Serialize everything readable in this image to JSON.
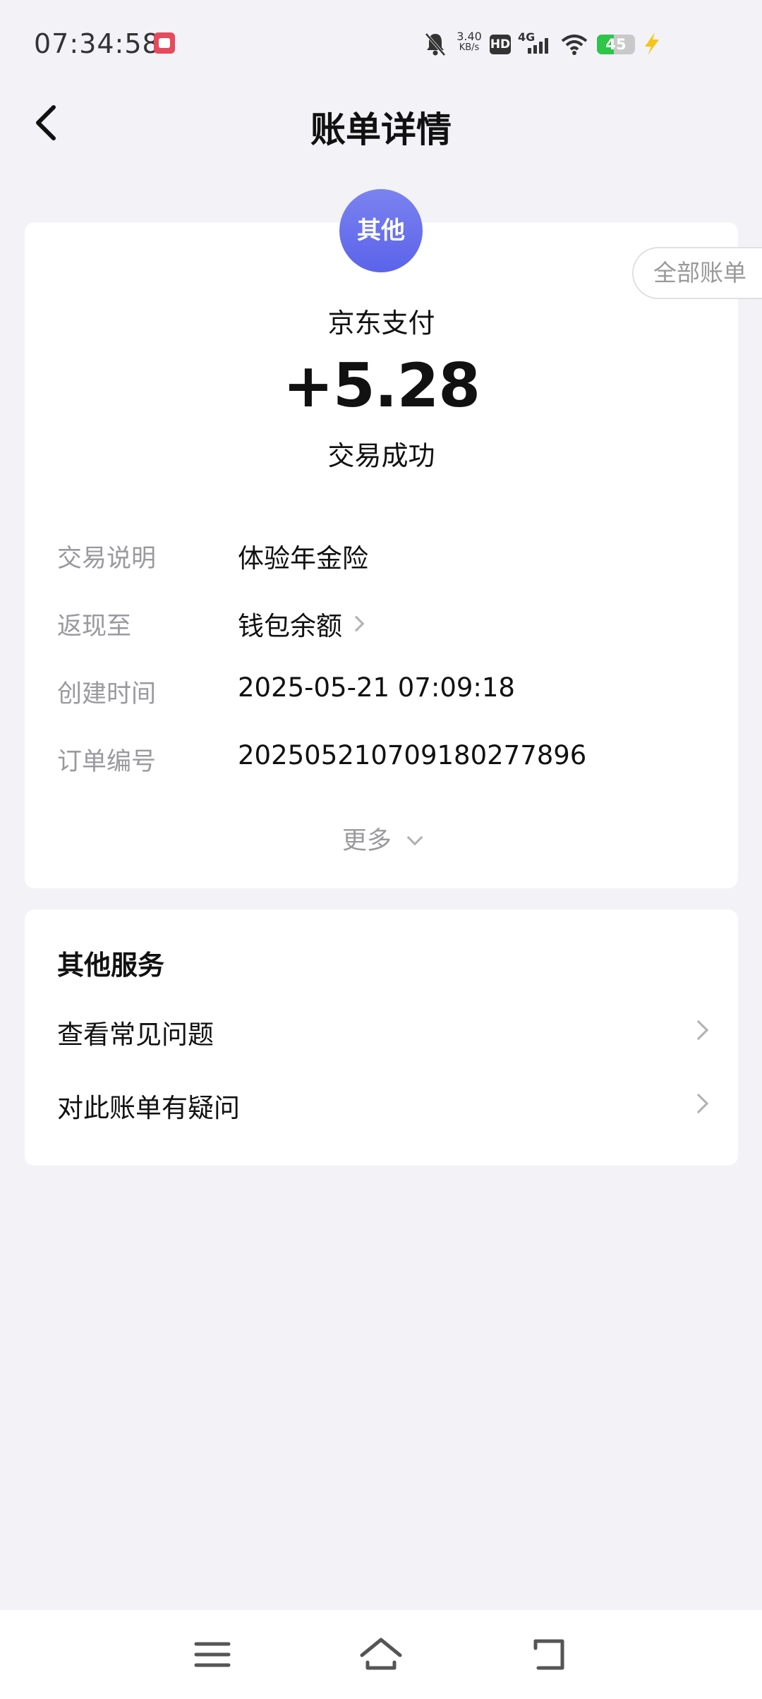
{
  "status_bar": {
    "time": "07:34:58",
    "net_speed_value": "3.40",
    "net_speed_unit": "KB/s",
    "hd_label": "HD",
    "network_label": "4G",
    "battery_level": "45",
    "battery_fraction": 0.45,
    "icons": [
      "app-icon",
      "mute-icon",
      "hd-icon",
      "signal-4g-icon",
      "wifi-icon",
      "battery-icon",
      "charging-icon"
    ]
  },
  "header": {
    "back_icon": "chevron-left-icon",
    "title": "账单详情"
  },
  "detail": {
    "category_badge": "其他",
    "all_bills_button": "全部账单",
    "merchant": "京东支付",
    "amount": "+5.28",
    "status": "交易成功",
    "rows": [
      {
        "label": "交易说明",
        "value": "体验年金险",
        "link": false
      },
      {
        "label": "返现至",
        "value": "钱包余额",
        "link": true
      },
      {
        "label": "创建时间",
        "value": "2025-05-21 07:09:18",
        "link": false
      },
      {
        "label": "订单编号",
        "value": "20250521070918027789 6",
        "link": false
      }
    ],
    "more_label": "更多"
  },
  "services": {
    "title": "其他服务",
    "items": [
      {
        "label": "查看常见问题"
      },
      {
        "label": "对此账单有疑问"
      }
    ]
  },
  "nav_bar": {
    "icons": [
      "menu-icon",
      "home-icon",
      "back-icon"
    ]
  },
  "colors": {
    "page_background": "#f2f2f7",
    "badge_gradient_top": "#7b82f0",
    "badge_gradient_bottom": "#5b63ea",
    "secondary_text": "#9a9a9e",
    "battery_green": "#2fc44a"
  }
}
